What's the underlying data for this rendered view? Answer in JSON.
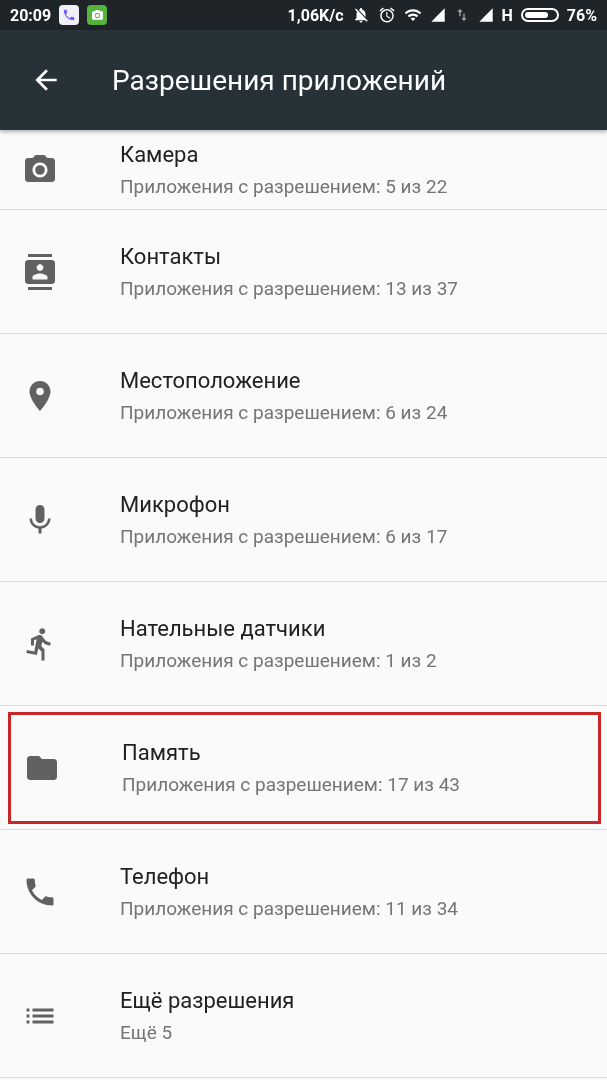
{
  "status_bar": {
    "time": "20:09",
    "speed": "1,06K/с",
    "network": "H",
    "battery": "76%"
  },
  "toolbar": {
    "title": "Разрешения приложений"
  },
  "permissions": [
    {
      "title": "Камера",
      "subtitle": "Приложения с разрешением: 5 из 22",
      "highlighted": false
    },
    {
      "title": "Контакты",
      "subtitle": "Приложения с разрешением: 13 из 37",
      "highlighted": false
    },
    {
      "title": "Местоположение",
      "subtitle": "Приложения с разрешением: 6 из 24",
      "highlighted": false
    },
    {
      "title": "Микрофон",
      "subtitle": "Приложения с разрешением: 6 из 17",
      "highlighted": false
    },
    {
      "title": "Нательные датчики",
      "subtitle": "Приложения с разрешением: 1 из 2",
      "highlighted": false
    },
    {
      "title": "Память",
      "subtitle": "Приложения с разрешением: 17 из 43",
      "highlighted": true
    },
    {
      "title": "Телефон",
      "subtitle": "Приложения с разрешением: 11 из 34",
      "highlighted": false
    },
    {
      "title": "Ещё разрешения",
      "subtitle": "Ещё 5",
      "highlighted": false
    }
  ]
}
